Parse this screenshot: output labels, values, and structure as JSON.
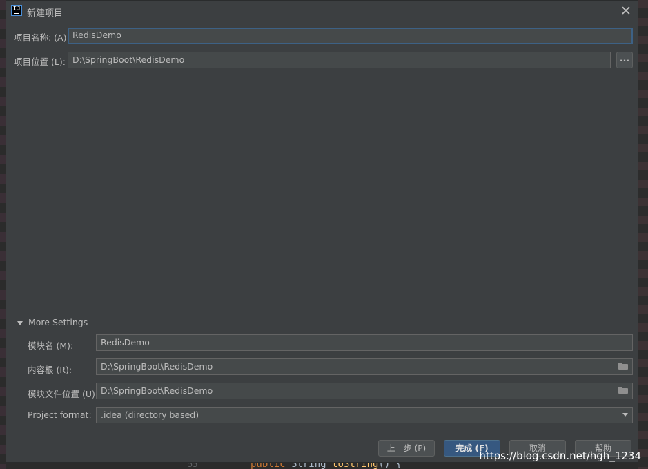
{
  "window": {
    "title": "新建项目",
    "icon": "intellij-app-icon"
  },
  "form": {
    "project_name": {
      "label": "项目名称: (A)",
      "value": "RedisDemo"
    },
    "project_location": {
      "label": "项目位置 (L):",
      "value": "D:\\SpringBoot\\RedisDemo",
      "browse_label": "..."
    }
  },
  "more_settings": {
    "toggle_label": "More Settings",
    "module_name": {
      "label": "模块名 (M):",
      "value": "RedisDemo"
    },
    "content_root": {
      "label": "内容根 (R):",
      "value": "D:\\SpringBoot\\RedisDemo"
    },
    "module_file_location": {
      "label": "模块文件位置 (U):",
      "value": "D:\\SpringBoot\\RedisDemo"
    },
    "project_format": {
      "label": "Project format:",
      "value": ".idea (directory based)"
    }
  },
  "buttons": {
    "previous": "上一步 (P)",
    "finish": "完成 (F)",
    "cancel": "取消",
    "help": "帮助"
  },
  "watermark": "https://blog.csdn.net/hgh_1234",
  "background_code": {
    "gutter": "55",
    "keyword": "public",
    "type": "String",
    "method": "toString",
    "rest": "() {"
  },
  "colors": {
    "dialog_bg": "#3c3f41",
    "field_bg": "#45494a",
    "focus_border": "#3d6185",
    "primary_button": "#365880"
  }
}
